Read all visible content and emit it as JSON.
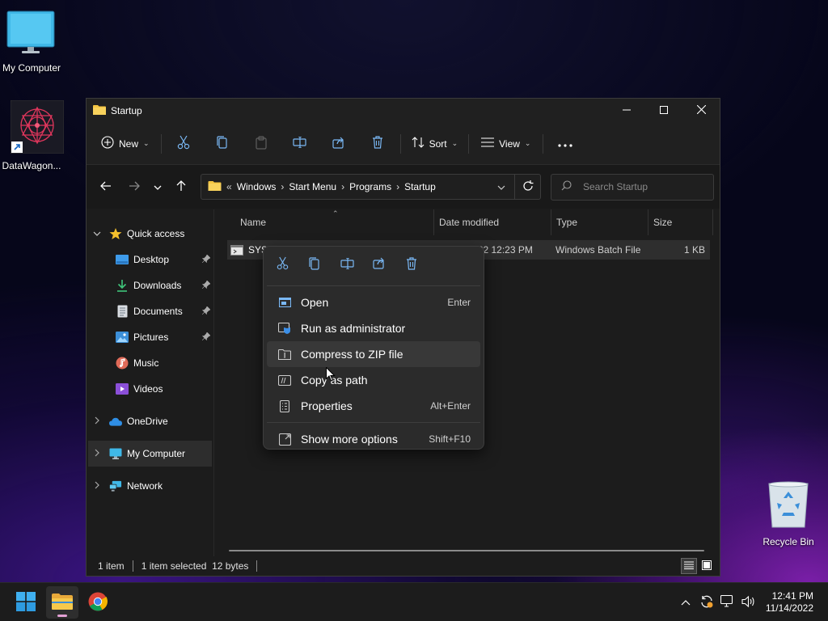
{
  "desktop": {
    "icons": [
      {
        "label": "My Computer"
      },
      {
        "label": "DataWagon..."
      },
      {
        "label": "Recycle Bin"
      }
    ]
  },
  "window": {
    "title": "Startup",
    "toolbar": {
      "new_label": "New",
      "sort_label": "Sort",
      "view_label": "View"
    },
    "address": {
      "overflow": "«",
      "crumbs": [
        "Windows",
        "Start Menu",
        "Programs",
        "Startup"
      ]
    },
    "search": {
      "placeholder": "Search Startup"
    },
    "nav": {
      "quick_access": "Quick access",
      "items": [
        {
          "label": "Desktop"
        },
        {
          "label": "Downloads"
        },
        {
          "label": "Documents"
        },
        {
          "label": "Pictures"
        },
        {
          "label": "Music"
        },
        {
          "label": "Videos"
        }
      ],
      "onedrive": "OneDrive",
      "my_computer": "My Computer",
      "network": "Network"
    },
    "columns": {
      "name": "Name",
      "date": "Date modified",
      "type": "Type",
      "size": "Size"
    },
    "file": {
      "name": "SYS",
      "date": "11/14/2022 12:23 PM",
      "type": "Windows Batch File",
      "size": "1 KB"
    },
    "status": {
      "count": "1 item",
      "selected": "1 item selected  12 bytes"
    }
  },
  "context_menu": {
    "items": [
      {
        "label": "Open",
        "shortcut": "Enter"
      },
      {
        "label": "Run as administrator",
        "shortcut": ""
      },
      {
        "label": "Compress to ZIP file",
        "shortcut": ""
      },
      {
        "label": "Copy as path",
        "shortcut": ""
      },
      {
        "label": "Properties",
        "shortcut": "Alt+Enter"
      },
      {
        "label": "Show more options",
        "shortcut": "Shift+F10"
      }
    ]
  },
  "taskbar": {
    "time": "12:41 PM",
    "date": "11/14/2022"
  },
  "colors": {
    "window_bg": "#1c1c1c",
    "menu_bg": "#2b2b2b",
    "folder_yellow": "#f4c542",
    "accent_blue": "#3b9ae8"
  }
}
